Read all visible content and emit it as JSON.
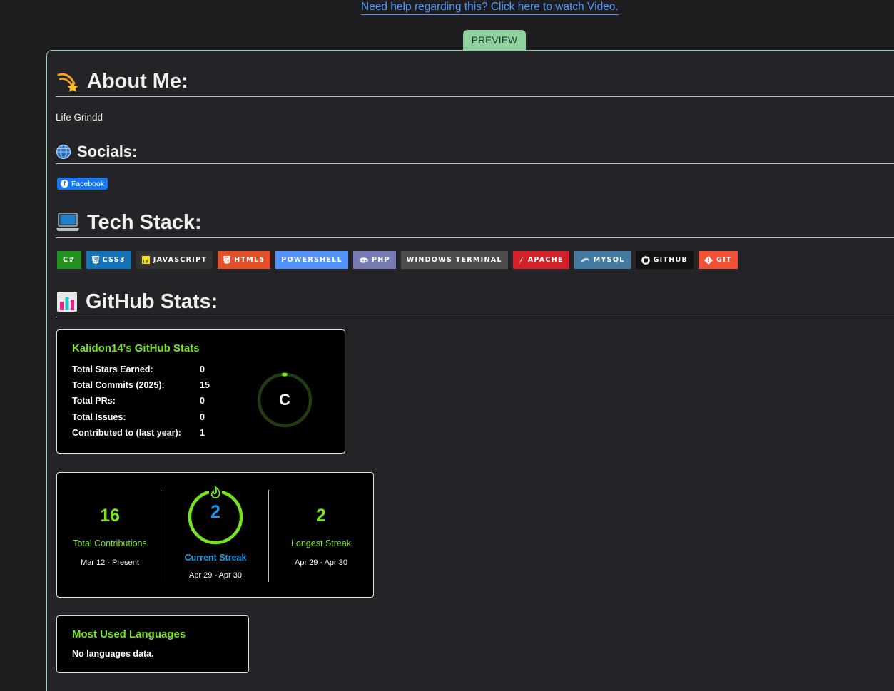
{
  "help_link": "Need help regarding this? Click here to watch Video.",
  "preview_tab": "PREVIEW",
  "about": {
    "title": "About Me:",
    "text": "Life Grindd"
  },
  "socials": {
    "title": "Socials:",
    "facebook_label": "Facebook"
  },
  "tech_stack": {
    "title": "Tech Stack:",
    "badges": [
      {
        "label": "C#",
        "color": "#239120"
      },
      {
        "label": "CSS3",
        "color": "#1572b6"
      },
      {
        "label": "JAVASCRIPT",
        "color": "#323330"
      },
      {
        "label": "HTML5",
        "color": "#e34f26"
      },
      {
        "label": "POWERSHELL",
        "color": "#5391fe"
      },
      {
        "label": "PHP",
        "color": "#777bb4"
      },
      {
        "label": "WINDOWS TERMINAL",
        "color": "#4d4d4d"
      },
      {
        "label": "APACHE",
        "color": "#d42029"
      },
      {
        "label": "MYSQL",
        "color": "#4479a1"
      },
      {
        "label": "GITHUB",
        "color": "#121011"
      },
      {
        "label": "GIT",
        "color": "#f05033"
      }
    ]
  },
  "github_stats": {
    "title": "GitHub Stats:",
    "stats_card": {
      "title": "Kalidon14's GitHub Stats",
      "rows": [
        {
          "label": "Total Stars Earned:",
          "value": "0"
        },
        {
          "label": "Total Commits (2025):",
          "value": "15"
        },
        {
          "label": "Total PRs:",
          "value": "0"
        },
        {
          "label": "Total Issues:",
          "value": "0"
        },
        {
          "label": "Contributed to (last year):",
          "value": "1"
        }
      ],
      "rank": "C"
    },
    "streak_card": {
      "total": {
        "value": "16",
        "label": "Total Contributions",
        "date": "Mar 12 - Present"
      },
      "current": {
        "value": "2",
        "label": "Current Streak",
        "date": "Apr 29 - Apr 30"
      },
      "longest": {
        "value": "2",
        "label": "Longest Streak",
        "date": "Apr 29 - Apr 30"
      }
    },
    "languages_card": {
      "title": "Most Used Languages",
      "text": "No languages data."
    }
  },
  "colors": {
    "accent_green": "#76e41f",
    "accent_blue": "#1e9bea",
    "preview_green": "#8fd29f",
    "link_blue": "#4f9bff"
  }
}
